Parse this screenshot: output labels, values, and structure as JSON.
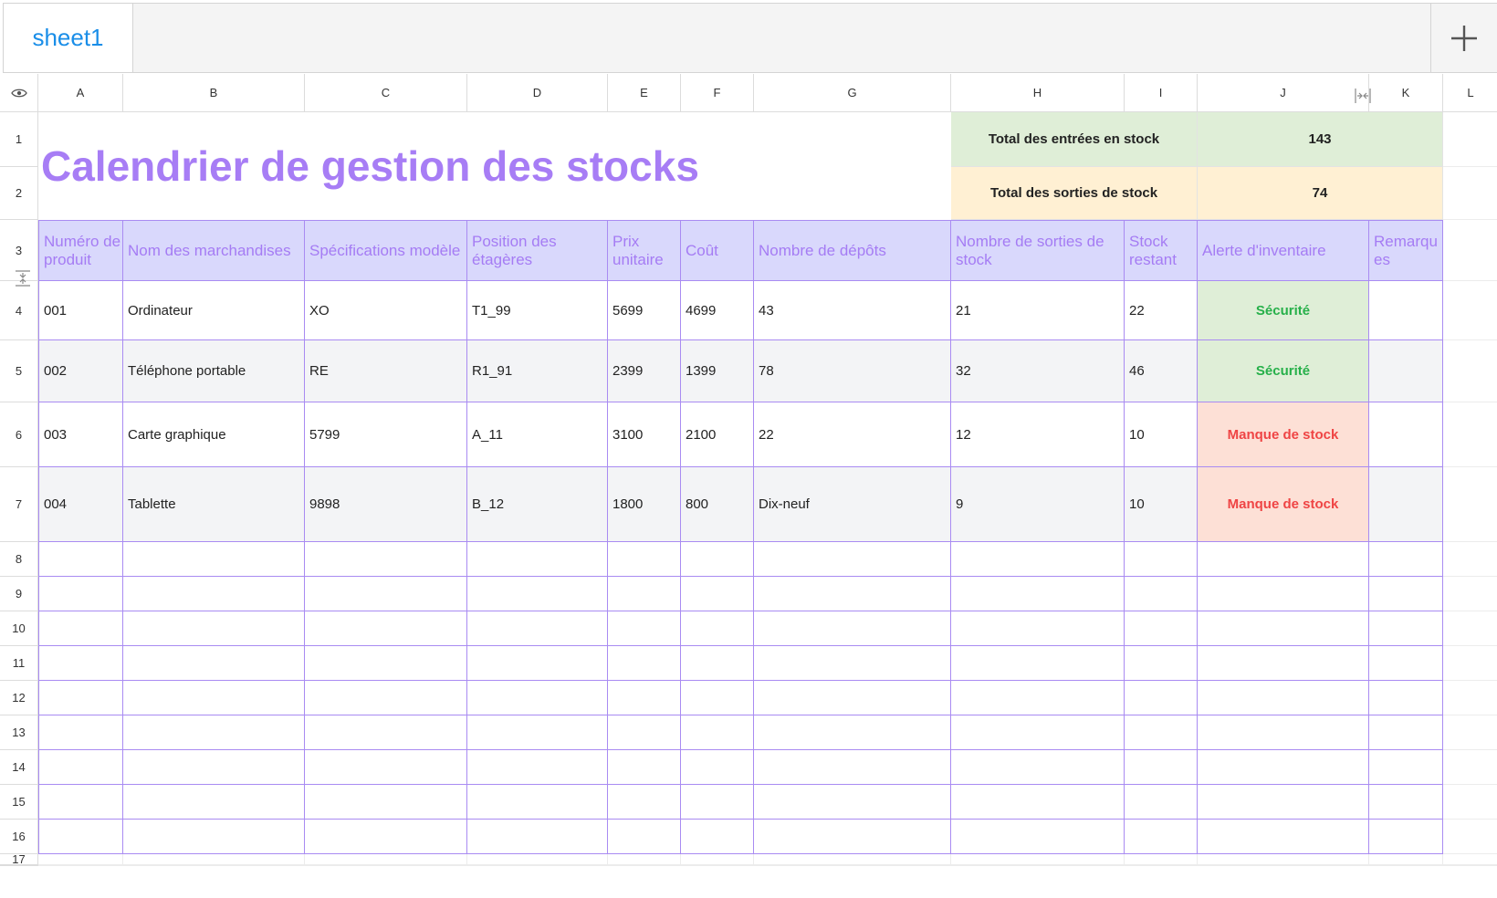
{
  "tabs": {
    "sheet_name": "sheet1",
    "add_icon": "plus-icon"
  },
  "columns": [
    "A",
    "B",
    "C",
    "D",
    "E",
    "F",
    "G",
    "H",
    "I",
    "J",
    "K",
    "L"
  ],
  "row_numbers": [
    "1",
    "2",
    "3",
    "4",
    "5",
    "6",
    "7",
    "8",
    "9",
    "10",
    "11",
    "12",
    "13",
    "14",
    "15",
    "16",
    "17"
  ],
  "title": "Calendrier de gestion des stocks",
  "summary": {
    "entries_label": "Total des entrées en stock",
    "entries_value": "143",
    "exits_label": "Total des sorties de stock",
    "exits_value": "74"
  },
  "headers": [
    "Numéro de produit",
    "Nom des marchandises",
    "Spécifications modèle",
    "Position des étagères",
    "Prix unitaire",
    "Coût",
    "Nombre de dépôts",
    "Nombre de sorties de stock",
    "Stock restant",
    "Alerte d'inventaire",
    "Remarques"
  ],
  "rows": [
    [
      "001",
      "Ordinateur",
      "XO",
      "T1_99",
      "5699",
      "4699",
      "43",
      "21",
      "22",
      "Sécurité",
      ""
    ],
    [
      "002",
      "Téléphone portable",
      "RE",
      "R1_91",
      "2399",
      "1399",
      "78",
      "32",
      "46",
      "Sécurité",
      ""
    ],
    [
      "003",
      "Carte graphique",
      "5799",
      "A_11",
      "3100",
      "2100",
      "22",
      "12",
      "10",
      "Manque de stock",
      ""
    ],
    [
      "004",
      "Tablette",
      "9898",
      "B_12",
      "1800",
      "800",
      "Dix-neuf",
      "9",
      "10",
      "Manque de stock",
      ""
    ]
  ],
  "colors": {
    "accent_purple": "#a57cf4",
    "header_fill": "#d9d8fc",
    "safe_fill": "#dfeed7",
    "safe_text": "#27b04a",
    "low_fill": "#fde0d6",
    "low_text": "#ef4444",
    "entries_fill": "#dfeed7",
    "exits_fill": "#fff0d3",
    "tab_text": "#1a8ee8"
  },
  "icons": {
    "visibility": "eye-icon",
    "col_resize": "column-resize-icon",
    "row_resize": "row-resize-icon"
  }
}
